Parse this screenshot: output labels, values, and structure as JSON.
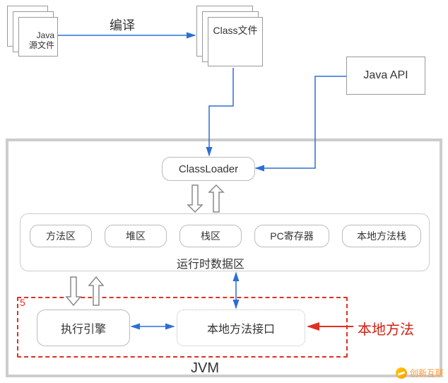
{
  "chart_data": {
    "type": "diagram",
    "title": "JVM",
    "nodes": [
      {
        "id": "java_source",
        "label": "Java\n源文件"
      },
      {
        "id": "compile",
        "label": "编译"
      },
      {
        "id": "class_file",
        "label": "Class文件"
      },
      {
        "id": "java_api",
        "label": "Java API"
      },
      {
        "id": "classloader",
        "label": "ClassLoader"
      },
      {
        "id": "runtime_area",
        "label": "运行时数据区"
      },
      {
        "id": "method_area",
        "label": "方法区"
      },
      {
        "id": "heap",
        "label": "堆区"
      },
      {
        "id": "stack",
        "label": "栈区"
      },
      {
        "id": "pc_register",
        "label": "PC寄存器"
      },
      {
        "id": "native_stack",
        "label": "本地方法栈"
      },
      {
        "id": "exec_engine",
        "label": "执行引擎"
      },
      {
        "id": "native_interface",
        "label": "本地方法接口"
      },
      {
        "id": "native_method",
        "label": "本地方法"
      },
      {
        "id": "jvm",
        "label": "JVM"
      },
      {
        "id": "section5",
        "label": "5"
      }
    ],
    "edges": [
      {
        "from": "java_source",
        "to": "class_file",
        "label": "编译"
      },
      {
        "from": "class_file",
        "to": "classloader"
      },
      {
        "from": "java_api",
        "to": "classloader"
      },
      {
        "from": "classloader",
        "to": "runtime_area",
        "bidir": true
      },
      {
        "from": "runtime_area",
        "to": "exec_engine",
        "bidir": true
      },
      {
        "from": "runtime_area",
        "to": "native_interface",
        "bidir": true
      },
      {
        "from": "exec_engine",
        "to": "native_interface",
        "bidir": true
      },
      {
        "from": "native_method",
        "to": "native_interface"
      }
    ]
  },
  "labels": {
    "java": "Java",
    "src": "源文件",
    "compile": "编译",
    "classfile": "Class文件",
    "javaapi": "Java API",
    "classloader": "ClassLoader",
    "method_area": "方法区",
    "heap": "堆区",
    "stack": "栈区",
    "pc": "PC寄存器",
    "native_stack": "本地方法栈",
    "runtime": "运行时数据区",
    "exec": "执行引擎",
    "native_if": "本地方法接口",
    "native_method": "本地方法",
    "jvm": "JVM",
    "five": "5",
    "watermark": "创新互联"
  }
}
